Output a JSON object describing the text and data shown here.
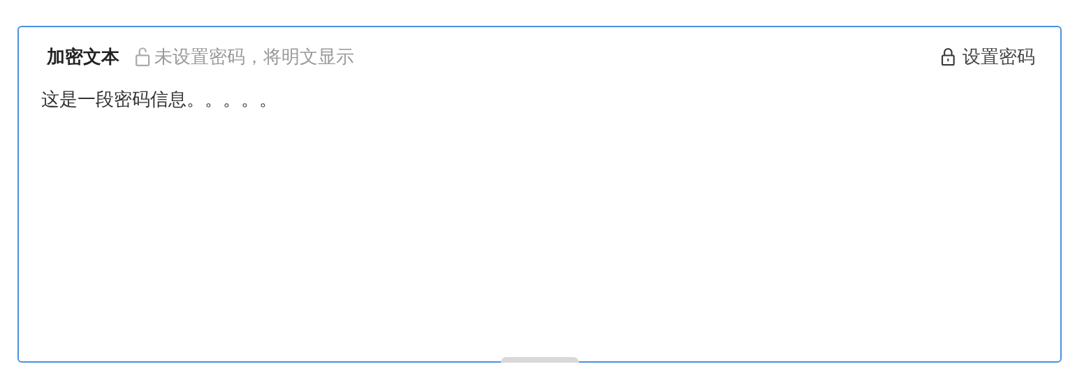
{
  "editor": {
    "title": "加密文本",
    "password_set": false,
    "status": "未设置密码，将明文显示",
    "action": "设置密码",
    "content": "这是一段密码信息。。。。。"
  }
}
